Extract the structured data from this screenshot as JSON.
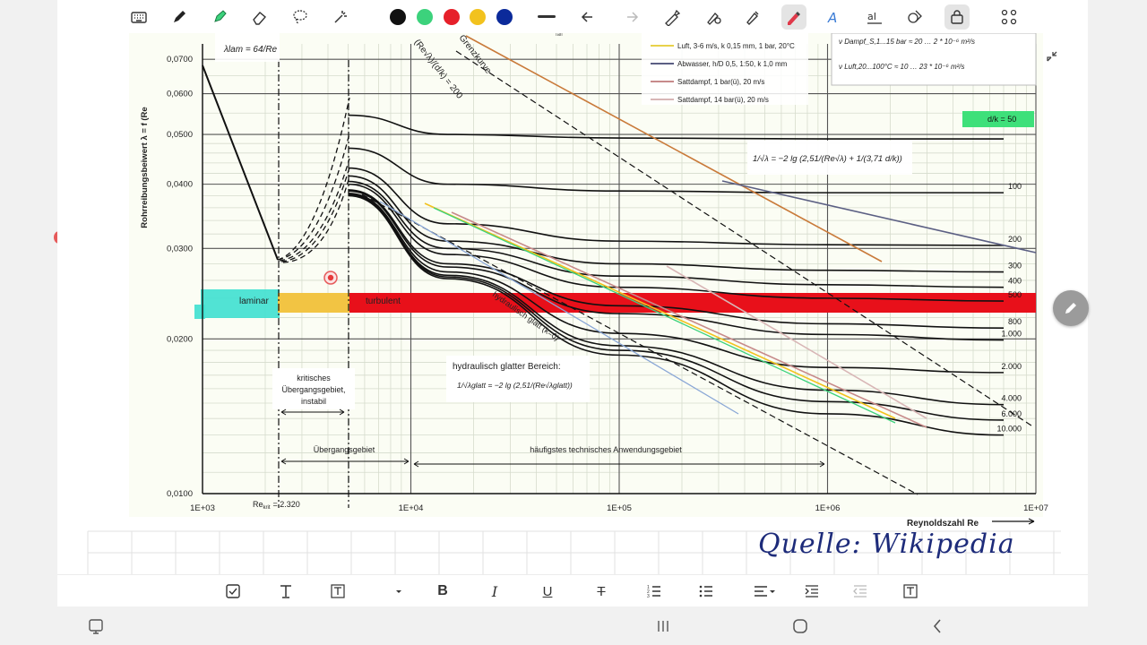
{
  "colors": {
    "chrome_bg": "#f1f1f1",
    "pen_black": "#111111",
    "pen_green": "#3cd27c",
    "pen_red": "#e6202a",
    "pen_yellow": "#f2c21e",
    "pen_blue": "#0b2a9a",
    "band_laminar": "#3ee0d0",
    "band_transition": "#f2c443",
    "band_turbulent": "#e8101a",
    "handwriting": "#1d2b7a"
  },
  "toolbar": {
    "icons": [
      "keyboard-icon",
      "pen-icon",
      "highlighter-icon",
      "eraser-icon",
      "lasso-icon",
      "magic-select-icon",
      "swatch-black",
      "swatch-green",
      "swatch-red",
      "swatch-yellow",
      "swatch-blue",
      "line-thickness-icon",
      "undo-icon",
      "redo-icon",
      "shape-pen-icon",
      "pen-settings-icon",
      "text-pen-icon",
      "active-pen-icon",
      "handwriting-to-text-icon",
      "text-recognize-icon",
      "shapes-icon",
      "lock-icon",
      "more-grid-icon"
    ]
  },
  "chart_data": {
    "type": "line",
    "ylabel": "Rohrreibungsbeiwert λ = f (Re",
    "xlabel": "Reynoldszahl Re",
    "x_scale": "log",
    "y_scale": "log",
    "xlim": [
      1000,
      10000000
    ],
    "ylim": [
      0.01,
      0.075
    ],
    "grid": true,
    "x_ticks": [
      "1E+03",
      "1E+04",
      "1E+05",
      "1E+06",
      "1E+07"
    ],
    "y_ticks": [
      "0,0700",
      "0,0600",
      "0,0500",
      "0,0400",
      "0,0300",
      "0,0200",
      "0,0100"
    ],
    "re_krit_label": "Re",
    "re_krit_sub": "krit",
    "re_krit_value": "= 2.320",
    "formula_laminar": "λlam = 64/Re",
    "formula_colebrook": "1/√λ = −2 lg (2,51/(Re√λ) + 1/(3,71 d/k))",
    "grenzkurve": "Grenzkurve",
    "grenzkurve_formula": "(Re√λ)/(d/k) = 200",
    "glatt_curve_label": "hydraulisch glatt (k=0)",
    "glatt_box_title": "hydraulisch glatter Bereich:",
    "glatt_box_formula": "1/√λglatt = −2 lg (2,51/(Re√λglatt))",
    "band_labels": {
      "laminar": "laminar",
      "turbulent": "turbulent"
    },
    "region_labels": {
      "kritisch": [
        "kritisches",
        "Übergangsgebiet,",
        "instabil"
      ],
      "uebergang": "Übergangsgebiet",
      "anwendung": "häufigstes technisches Anwendungsgebiet"
    },
    "viscosity_lines": [
      "ν Dampf_S,1...15 bar ≈ 20 … 2 * 10⁻⁶ m²/s",
      "ν Luft,20...100°C ≈ 10 … 23 * 10⁻⁶ m²/s"
    ],
    "top_cut_label": "fail",
    "legend": [
      {
        "label": "Luft, 3-6 m/s, k 0,15 mm, 1 bar, 20°C",
        "color": "#e8d24a"
      },
      {
        "label": "Abwasser, h/D 0,5, 1:50, k 1,0 mm",
        "color": "#5b5f83"
      },
      {
        "label": "Sattdampf, 1 bar(ü), 20 m/s",
        "color": "#c78a8a"
      },
      {
        "label": "Sattdampf, 14 bar(ü), 20 m/s",
        "color": "#d8b6b6"
      }
    ],
    "series": [
      {
        "name": "50",
        "label": "d/k = 50",
        "values": [
          0.0545,
          0.05,
          0.0492,
          0.049,
          0.049
        ]
      },
      {
        "name": "100",
        "values": [
          0.047,
          0.04,
          0.0388,
          0.0385,
          0.0385
        ]
      },
      {
        "name": "200",
        "values": [
          0.043,
          0.0335,
          0.031,
          0.0305,
          0.0304
        ]
      },
      {
        "name": "300",
        "values": [
          0.0415,
          0.031,
          0.028,
          0.0272,
          0.027
        ]
      },
      {
        "name": "400",
        "values": [
          0.0405,
          0.03,
          0.0265,
          0.0255,
          0.0252
        ]
      },
      {
        "name": "500",
        "values": [
          0.04,
          0.0292,
          0.0252,
          0.024,
          0.0237
        ]
      },
      {
        "name": "800",
        "values": [
          0.039,
          0.028,
          0.0232,
          0.0214,
          0.021
        ]
      },
      {
        "name": "1.000",
        "values": [
          0.0388,
          0.0276,
          0.0224,
          0.0204,
          0.0199
        ]
      },
      {
        "name": "2.000",
        "values": [
          0.0384,
          0.027,
          0.0205,
          0.0176,
          0.0172
        ]
      },
      {
        "name": "4.000",
        "values": [
          0.0382,
          0.0266,
          0.0194,
          0.0159,
          0.0149
        ]
      },
      {
        "name": "6.000",
        "values": [
          0.0381,
          0.0264,
          0.019,
          0.0151,
          0.0139
        ]
      },
      {
        "name": "10.000",
        "values": [
          0.038,
          0.0262,
          0.0186,
          0.0143,
          0.013
        ]
      }
    ],
    "series_x": [
      5000,
      15000,
      100000,
      1000000,
      7000000
    ]
  },
  "bottombar": {
    "icons": [
      "checkbox-icon",
      "text-icon",
      "text-box-icon",
      "dropdown-icon",
      "bold-icon",
      "italic-icon",
      "underline-icon",
      "strikethrough-icon",
      "numbered-list-icon",
      "bullet-list-icon",
      "align-icon",
      "indent-icon",
      "outdent-icon",
      "text-frame-icon"
    ]
  },
  "navbar": {
    "icons": [
      "screenshot-icon",
      "recents-icon",
      "home-icon",
      "back-icon"
    ]
  },
  "source_note": "Quelle: Wikipedia"
}
